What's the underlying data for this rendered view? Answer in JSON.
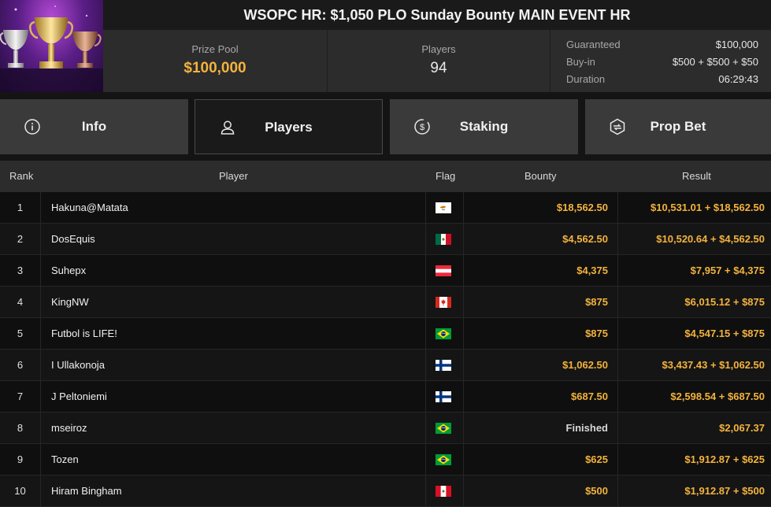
{
  "header": {
    "title": "WSOPC HR: $1,050 PLO Sunday Bounty MAIN EVENT HR",
    "prize_pool_label": "Prize Pool",
    "prize_pool_value": "$100,000",
    "players_label": "Players",
    "players_value": "94",
    "details": [
      {
        "label": "Guaranteed",
        "value": "$100,000"
      },
      {
        "label": "Buy-in",
        "value": "$500 + $500 + $50"
      },
      {
        "label": "Duration",
        "value": "06:29:43"
      }
    ]
  },
  "tabs": [
    {
      "label": "Info",
      "icon": "info-icon",
      "active": false
    },
    {
      "label": "Players",
      "icon": "user-icon",
      "active": true
    },
    {
      "label": "Staking",
      "icon": "dollar-coin-icon",
      "active": false
    },
    {
      "label": "Prop Bet",
      "icon": "prop-bet-icon",
      "active": false
    }
  ],
  "table": {
    "columns": {
      "rank": "Rank",
      "player": "Player",
      "flag": "Flag",
      "bounty": "Bounty",
      "result": "Result"
    },
    "rows": [
      {
        "rank": "1",
        "player": "Hakuna@Matata",
        "flag": "cyprus",
        "bounty": "$18,562.50",
        "result": "$10,531.01 + $18,562.50"
      },
      {
        "rank": "2",
        "player": "DosEquis",
        "flag": "mexico",
        "bounty": "$4,562.50",
        "result": "$10,520.64 + $4,562.50"
      },
      {
        "rank": "3",
        "player": "Suhepx",
        "flag": "austria",
        "bounty": "$4,375",
        "result": "$7,957 + $4,375"
      },
      {
        "rank": "4",
        "player": "KingNW",
        "flag": "canada",
        "bounty": "$875",
        "result": "$6,015.12 + $875"
      },
      {
        "rank": "5",
        "player": "Futbol is LIFE!",
        "flag": "brazil",
        "bounty": "$875",
        "result": "$4,547.15 + $875"
      },
      {
        "rank": "6",
        "player": "I Ullakonoja",
        "flag": "finland",
        "bounty": "$1,062.50",
        "result": "$3,437.43 + $1,062.50"
      },
      {
        "rank": "7",
        "player": "J Peltoniemi",
        "flag": "finland",
        "bounty": "$687.50",
        "result": "$2,598.54 + $687.50"
      },
      {
        "rank": "8",
        "player": "mseiroz",
        "flag": "brazil",
        "bounty": "Finished",
        "result": "$2,067.37"
      },
      {
        "rank": "9",
        "player": "Tozen",
        "flag": "brazil",
        "bounty": "$625",
        "result": "$1,912.87 + $625"
      },
      {
        "rank": "10",
        "player": "Hiram Bingham",
        "flag": "peru",
        "bounty": "$500",
        "result": "$1,912.87 + $500"
      }
    ]
  },
  "colors": {
    "accent": "#f3b33d",
    "tab_bg": "#3a3a3a",
    "header_bg": "#2c2c2c"
  }
}
